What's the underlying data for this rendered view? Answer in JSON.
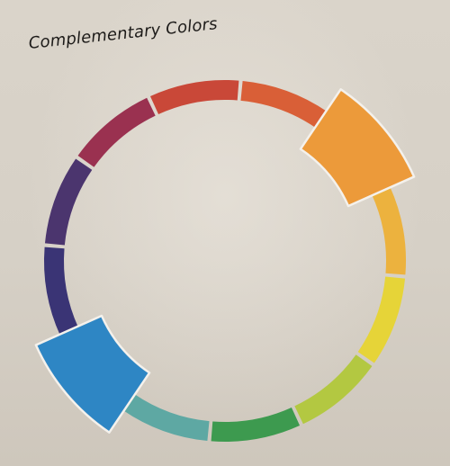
{
  "title": "Complementary Colors",
  "wheel": {
    "segments": [
      {
        "hue": "red",
        "color": "#c94838"
      },
      {
        "hue": "red-orange",
        "color": "#d95f37"
      },
      {
        "hue": "orange",
        "color": "#ec9a3a",
        "highlighted": true
      },
      {
        "hue": "yellow-orange",
        "color": "#ecb23e"
      },
      {
        "hue": "yellow",
        "color": "#e6d438"
      },
      {
        "hue": "yellow-green",
        "color": "#b3c841"
      },
      {
        "hue": "green",
        "color": "#3d9a4f"
      },
      {
        "hue": "blue-green",
        "color": "#5ea8a3"
      },
      {
        "hue": "blue",
        "color": "#2e86c4",
        "highlighted": true
      },
      {
        "hue": "blue-violet",
        "color": "#3a3475"
      },
      {
        "hue": "violet",
        "color": "#4b356e"
      },
      {
        "hue": "red-violet",
        "color": "#9a3150"
      }
    ],
    "complementary_pair": [
      "orange",
      "blue"
    ]
  }
}
